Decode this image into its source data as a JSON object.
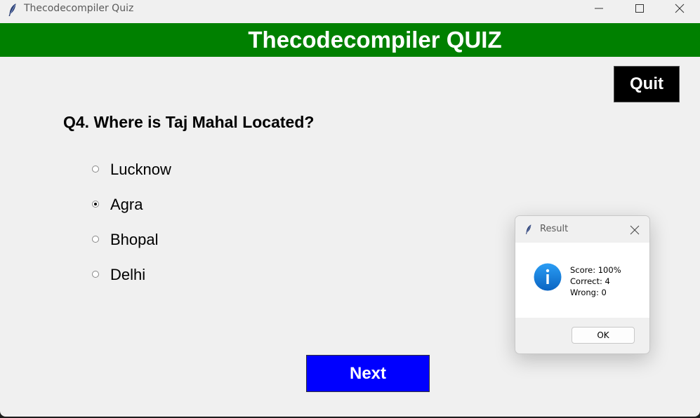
{
  "window": {
    "title": "Thecodecompiler Quiz"
  },
  "header": {
    "title": "Thecodecompiler QUIZ",
    "color": "#008000"
  },
  "quit_button": {
    "label": "Quit"
  },
  "question": {
    "text": "Q4. Where is Taj Mahal Located?",
    "options": [
      {
        "label": "Lucknow",
        "selected": false
      },
      {
        "label": "Agra",
        "selected": true
      },
      {
        "label": "Bhopal",
        "selected": false
      },
      {
        "label": "Delhi",
        "selected": false
      }
    ]
  },
  "next_button": {
    "label": "Next",
    "color": "#0000ff"
  },
  "result_dialog": {
    "title": "Result",
    "icon": "info-icon",
    "lines": [
      "Score: 100%",
      "Correct: 4",
      "Wrong: 0"
    ],
    "ok_label": "OK"
  }
}
